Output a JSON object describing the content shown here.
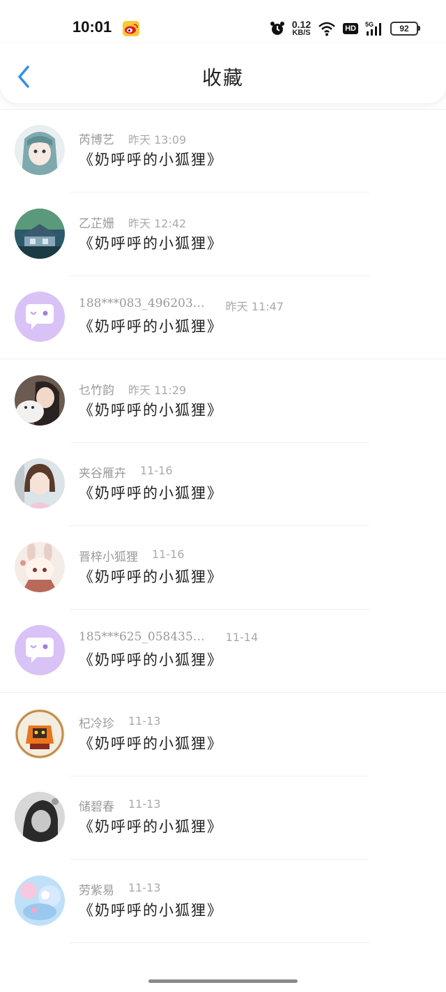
{
  "status_bar": {
    "time": "10:01",
    "net_speed": "0.12",
    "net_unit": "KB/S",
    "hd": "HD",
    "signal_label": "5G",
    "battery": "92",
    "icons": [
      "weibo-icon",
      "alarm-icon",
      "wifi-icon",
      "signal-icon",
      "battery-icon"
    ]
  },
  "header": {
    "title": "收藏",
    "back_icon": "chevron-left-icon"
  },
  "colors": {
    "accent": "#2f8fe8",
    "name_gray": "#9a9a9a",
    "default_avatar": "#d8c2f6"
  },
  "items": [
    {
      "name": "",
      "time": "",
      "song": "《奶呼呼的小狐狸》",
      "avatar": "partial-photo"
    },
    {
      "name": "芮博艺",
      "time": "昨天 13:09",
      "song": "《奶呼呼的小狐狸》",
      "avatar": "anime-girl"
    },
    {
      "name": "乙芷姗",
      "time": "昨天 12:42",
      "song": "《奶呼呼的小狐狸》",
      "avatar": "house-landscape"
    },
    {
      "name": "188***083_496203…",
      "time": "昨天 11:47",
      "song": "《奶呼呼的小狐狸》",
      "avatar": "default-chat"
    },
    {
      "name": "乜竹韵",
      "time": "昨天 11:29",
      "song": "《奶呼呼的小狐狸》",
      "avatar": "girl-with-cat"
    },
    {
      "name": "夹谷雁卉",
      "time": "11-16",
      "song": "《奶呼呼的小狐狸》",
      "avatar": "girl-portrait"
    },
    {
      "name": "晋梓小狐狸",
      "time": "11-16",
      "song": "《奶呼呼的小狐狸》",
      "avatar": "anime-bunny"
    },
    {
      "name": "185***625_058435…",
      "time": "11-14",
      "song": "《奶呼呼的小狐狸》",
      "avatar": "default-chat"
    },
    {
      "name": "杞冷珍",
      "time": "11-13",
      "song": "《奶呼呼的小狐狸》",
      "avatar": "game-character"
    },
    {
      "name": "储碧春",
      "time": "11-13",
      "song": "《奶呼呼的小狐狸》",
      "avatar": "bw-photo"
    },
    {
      "name": "劳紫易",
      "time": "11-13",
      "song": "《奶呼呼的小狐狸》",
      "avatar": "pastel-art"
    }
  ]
}
